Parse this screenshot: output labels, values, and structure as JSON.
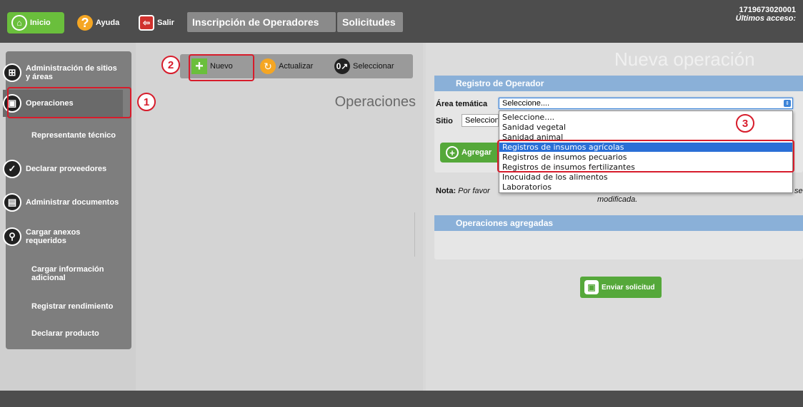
{
  "topbar": {
    "inicio_label": "Inicio",
    "ayuda_label": "Ayuda",
    "salir_label": "Salir",
    "tab_inscripcion": "Inscripción de Operadores",
    "tab_solicitudes": "Solicitudes",
    "user_id": "1719673020001",
    "last_access": "Últimos acceso:"
  },
  "sidebar": {
    "items": [
      {
        "label": "Administración de sitios y áreas",
        "icon": "sitemap-icon"
      },
      {
        "label": "Operaciones",
        "icon": "operations-icon"
      },
      {
        "label": "Representante técnico",
        "icon": ""
      },
      {
        "label": "Declarar proveedores",
        "icon": "checklist-icon"
      },
      {
        "label": "Administrar documentos",
        "icon": "documents-icon"
      },
      {
        "label": "Cargar anexos requeridos",
        "icon": "paperclip-icon"
      },
      {
        "label": "Cargar información adicional",
        "icon": ""
      },
      {
        "label": "Registrar rendimiento",
        "icon": ""
      },
      {
        "label": "Declarar producto",
        "icon": ""
      }
    ]
  },
  "middle": {
    "toolbar": {
      "nuevo": "Nuevo",
      "actualizar": "Actualizar",
      "seleccionar": "Seleccionar"
    },
    "title": "Operaciones"
  },
  "right": {
    "title": "Nueva operación",
    "registro_header": "Registro de Operador",
    "area_label": "Área temática",
    "area_value": "Seleccione....",
    "sitio_label": "Sitio",
    "sitio_value": "Seleccione....",
    "agregar_label": "Agregar",
    "nota_label": "Nota:",
    "nota_text": "Por favor",
    "nota_end": "se",
    "nota_mod": "modificada.",
    "operaciones_header": "Operaciones agregadas",
    "enviar_label": "Enviar solicitud",
    "dropdown_options": [
      "Seleccione....",
      "Sanidad vegetal",
      "Sanidad animal",
      "Registros de insumos agrícolas",
      "Registros de insumos pecuarios",
      "Registros de insumos fertilizantes",
      "Inocuidad de los alimentos",
      "Laboratorios"
    ],
    "dropdown_selected": "Registros de insumos agrícolas"
  },
  "annotations": [
    "1",
    "2",
    "3"
  ],
  "colors": {
    "accent_green": "#6abf3c",
    "annotation_red": "#d71c2b",
    "panel_header_blue": "#8ab0d8",
    "dropdown_highlight": "#2a6fd6"
  }
}
